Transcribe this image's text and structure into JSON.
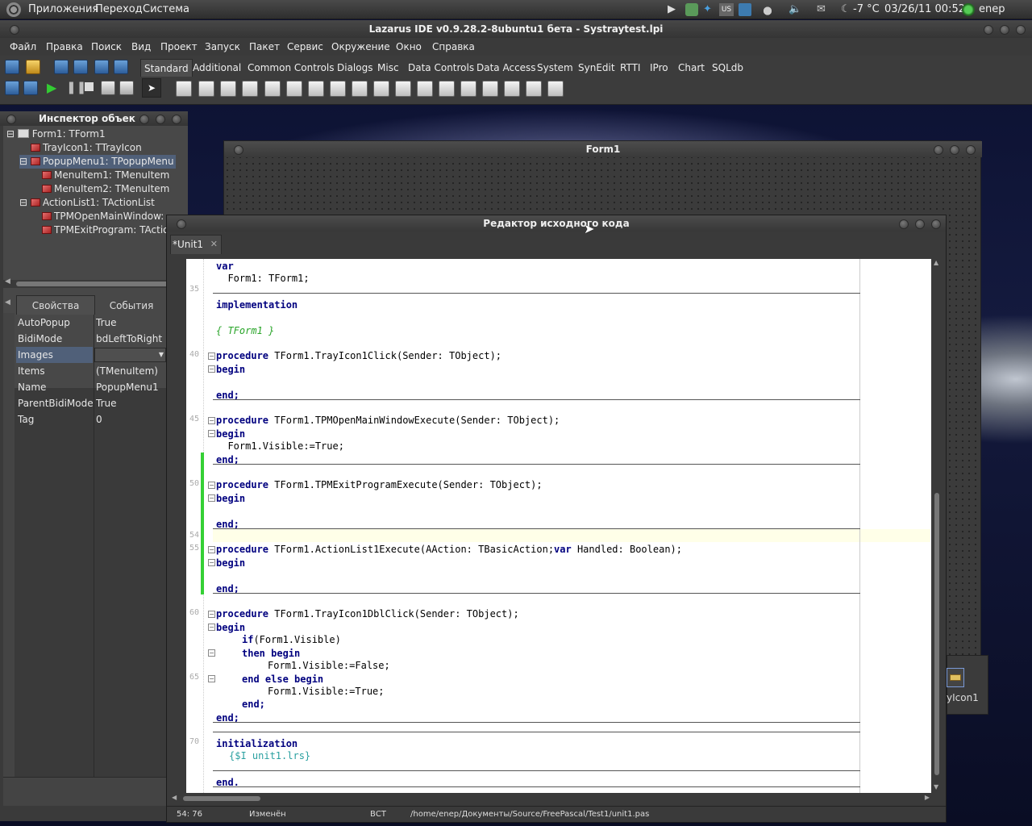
{
  "top_panel": {
    "menus": [
      "Приложения",
      "Переход",
      "Система"
    ],
    "temperature": "-7 °C",
    "datetime": "03/26/11 00:52",
    "user": "enep",
    "keyboard_layout": "us"
  },
  "ide": {
    "title": "Lazarus IDE v0.9.28.2-8ubuntu1 бета - Systraytest.lpi",
    "menu": [
      "Файл",
      "Правка",
      "Поиск",
      "Вид",
      "Проект",
      "Запуск",
      "Пакет",
      "Сервис",
      "Окружение",
      "Окно",
      "Справка"
    ],
    "palette_tabs": [
      "Standard",
      "Additional",
      "Common Controls",
      "Dialogs",
      "Misc",
      "Data Controls",
      "Data Access",
      "System",
      "SynEdit",
      "RTTI",
      "IPro",
      "Chart",
      "SQLdb"
    ],
    "active_tab": "Standard"
  },
  "inspector": {
    "title": "Инспектор объек",
    "tree": [
      {
        "label": "Form1: TForm1",
        "level": 0
      },
      {
        "label": "TrayIcon1: TTrayIcon",
        "level": 1
      },
      {
        "label": "PopupMenu1: TPopupMenu",
        "level": 1,
        "selected": true
      },
      {
        "label": "MenuItem1: TMenuItem",
        "level": 2
      },
      {
        "label": "MenuItem2: TMenuItem",
        "level": 2
      },
      {
        "label": "ActionList1: TActionList",
        "level": 1
      },
      {
        "label": "TPMOpenMainWindow: TA",
        "level": 2
      },
      {
        "label": "TPMExitProgram: TAction",
        "level": 2
      }
    ],
    "tab_properties": "Свойства",
    "tab_events": "События",
    "properties": [
      {
        "name": "AutoPopup",
        "value": "True"
      },
      {
        "name": "BidiMode",
        "value": "bdLeftToRight"
      },
      {
        "name": "Images",
        "value": ""
      },
      {
        "name": "Items",
        "value": "(TMenuItem)"
      },
      {
        "name": "Name",
        "value": "PopupMenu1"
      },
      {
        "name": "ParentBidiMode",
        "value": "True"
      },
      {
        "name": "Tag",
        "value": "0"
      }
    ]
  },
  "form_designer": {
    "title": "Form1",
    "component_caption": "yIcon1"
  },
  "editor": {
    "title": "Редактор исходного кода",
    "tab": "*Unit1",
    "status": {
      "position": "54: 76",
      "modified": "Изменён",
      "mode": "ВСТ",
      "path": "/home/enep/Документы/Source/FreePascal/Test1/unit1.pas"
    },
    "line_numbers": [
      "35",
      "40",
      "45",
      "50",
      "54",
      "55",
      "60",
      "65",
      "70"
    ],
    "code": {
      "l1_kw": "var",
      "l2": "  Form1: TForm1;",
      "l3_kw": "implementation",
      "l4_cm": "{ TForm1 }",
      "p1_kw": "procedure",
      "p1": " TForm1.TrayIcon1Click(Sender: TObject);",
      "begin": "begin",
      "end": "end;",
      "p2": " TForm1.TPMOpenMainWindowExecute(Sender: TObject);",
      "p2_body": "  Form1.Visible:=True;",
      "p3": " TForm1.TPMExitProgramExecute(Sender: TObject);",
      "p4a": " TForm1.ActionList1Execute(AAction: TBasicAction;",
      "p4_var": "var",
      "p4b": " Handled: Boolean);",
      "p5": " TForm1.TrayIcon1DblClick(Sender: TObject);",
      "if_kw": "if",
      "if_rest": "(Form1.Visible)",
      "then_begin": "then begin",
      "set_false": "Form1.Visible:=False;",
      "end_else_begin": "end else begin",
      "set_true": "Form1.Visible:=True;",
      "init_kw": "initialization",
      "init_dir": "{$I unit1.lrs}",
      "final_end": "end."
    }
  }
}
